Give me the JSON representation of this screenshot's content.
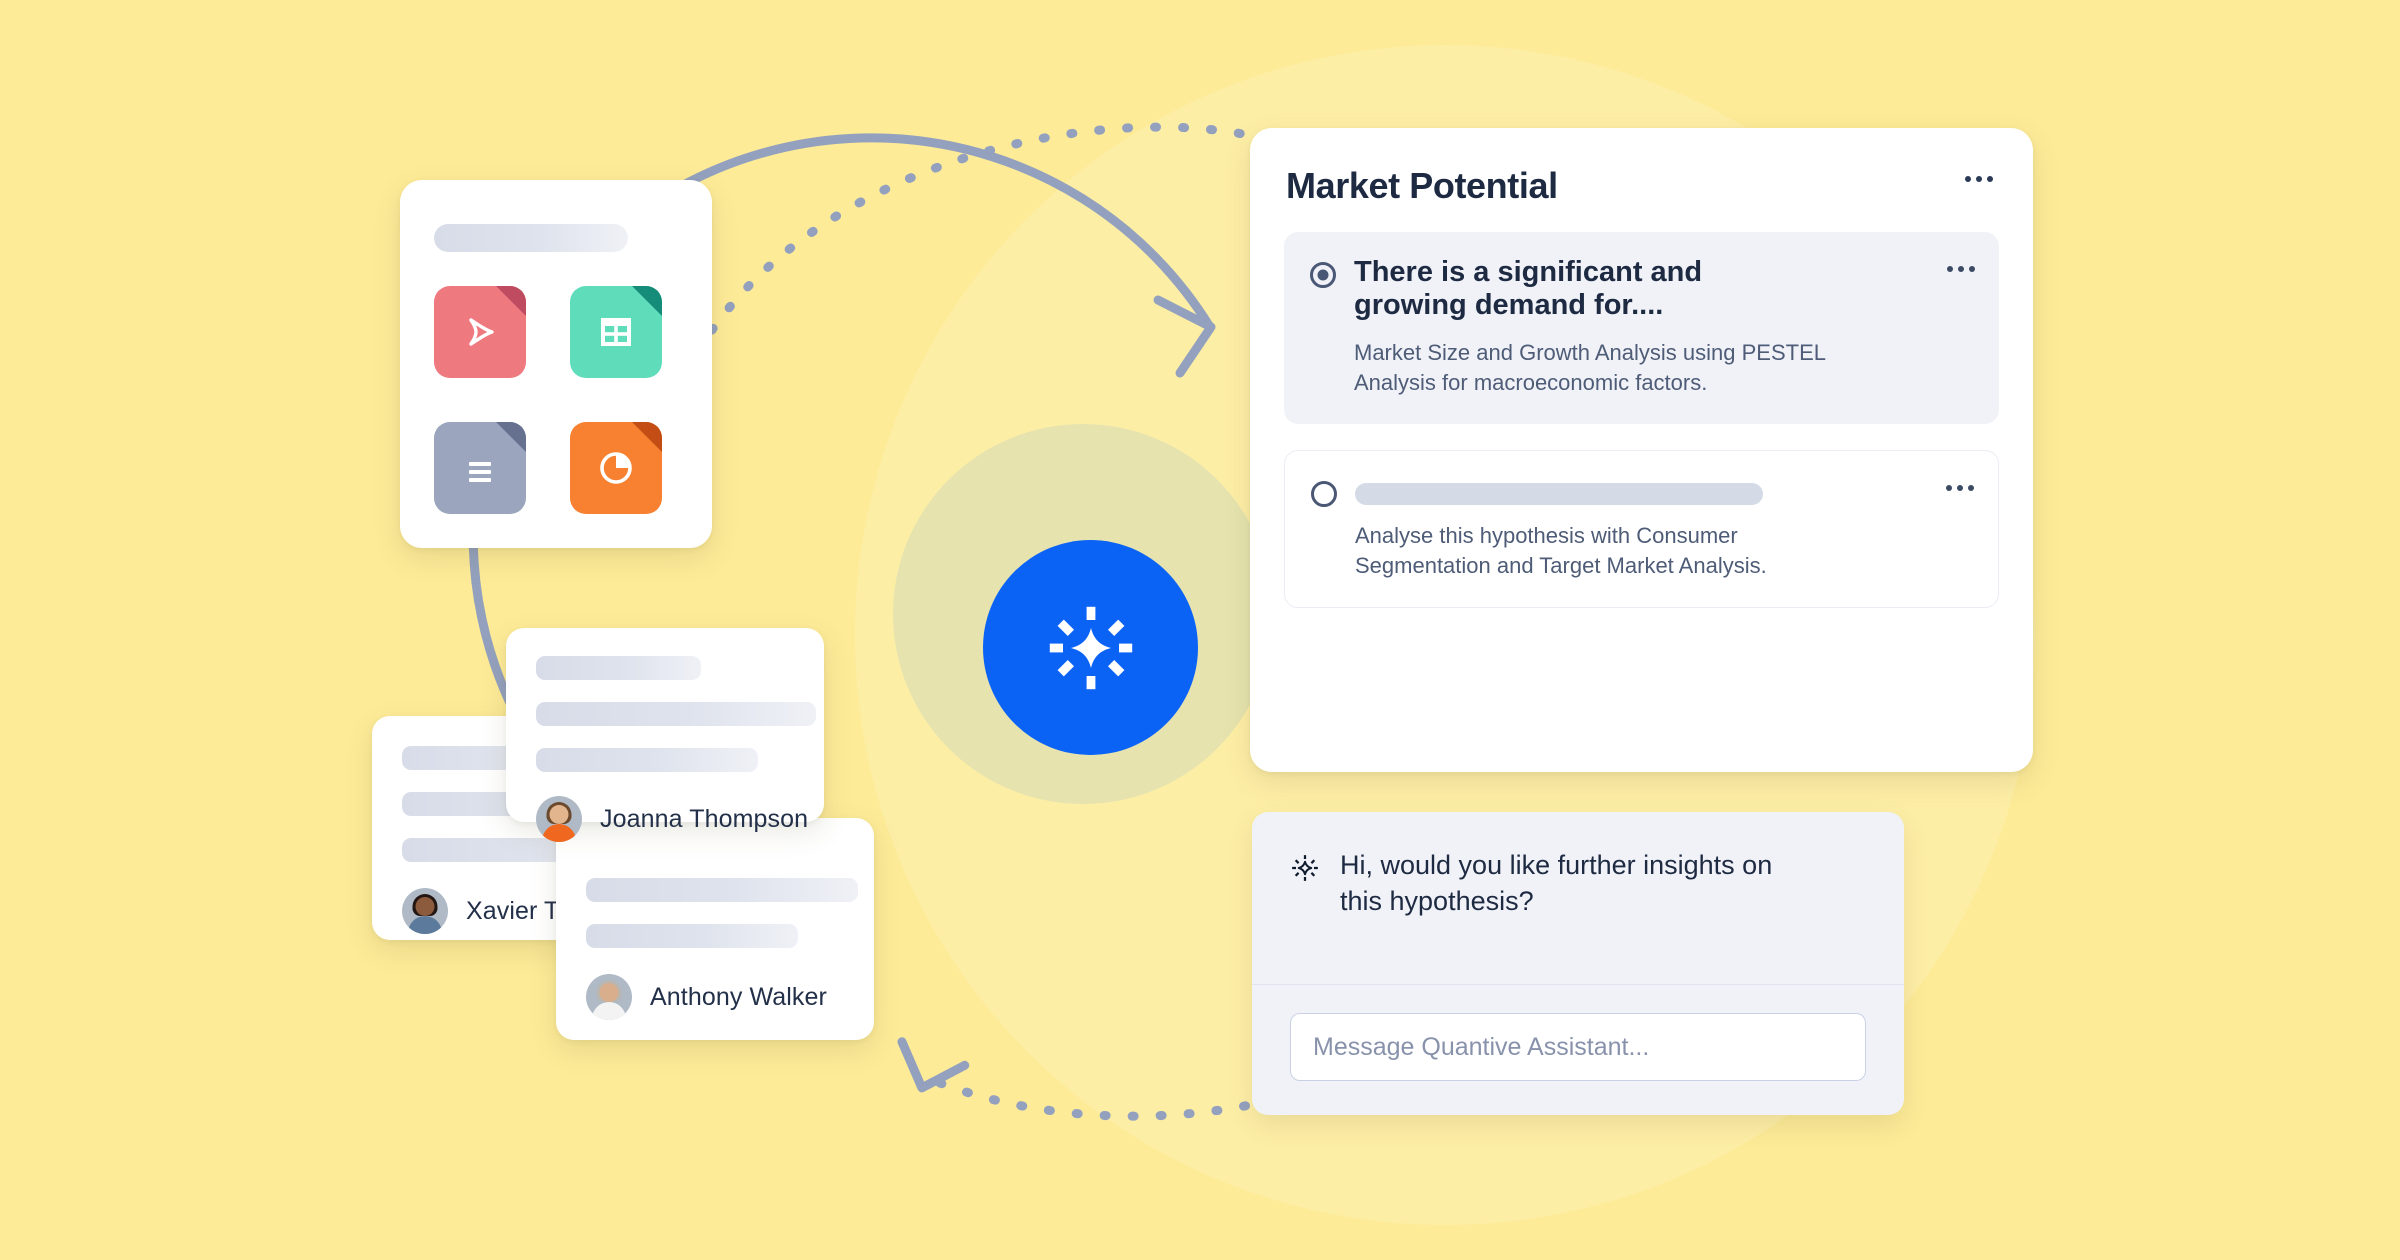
{
  "theme": {
    "background": "#FDEB98",
    "soft_circle": "#FCEFAC",
    "halo": "#E6E3AE",
    "orb": "#0B63F6",
    "accent_text": "#1D2A42",
    "muted_text": "#4E5C77",
    "panel": "#F0F2F8",
    "arc_stroke": "#93A1BE"
  },
  "orb": {
    "icon": "sparkle-icon"
  },
  "files_card": {
    "title_placeholder": "",
    "tiles": [
      {
        "name": "pdf-file-icon",
        "label": "PDF",
        "color": "#EE7A80",
        "fold": "#BE4B5F"
      },
      {
        "name": "spreadsheet-file-icon",
        "label": "Spreadsheet",
        "color": "#5FDDBB",
        "fold": "#158C79"
      },
      {
        "name": "document-file-icon",
        "label": "Document",
        "color": "#9BA6BE",
        "fold": "#66718F"
      },
      {
        "name": "chart-file-icon",
        "label": "Chart",
        "color": "#F78031",
        "fold": "#C34D15"
      }
    ]
  },
  "people_cards": [
    {
      "name": "Xavier Tu",
      "avatar": "xavier-avatar",
      "skin": "#8C5B3E",
      "hair": "#241713",
      "shirt": "#5C7A9B"
    },
    {
      "name": "Joanna Thompson",
      "avatar": "joanna-avatar",
      "skin": "#E2B58F",
      "hair": "#6B4A2E",
      "shirt": "#F0681F"
    },
    {
      "name": "Anthony Walker",
      "avatar": "anthony-avatar",
      "skin": "#D8AE8C",
      "hair": "#B9B6B2",
      "shirt": "#F3F3F3"
    }
  ],
  "market_card": {
    "title": "Market Potential",
    "menu_icon": "more-options-icon",
    "hypotheses": [
      {
        "selected": true,
        "title": "There is a significant and growing demand for....",
        "subtitle": "Market Size and Growth Analysis using PESTEL Analysis for macroeconomic factors.",
        "has_skeleton_title": false,
        "menu_icon": "more-options-icon"
      },
      {
        "selected": false,
        "title": "",
        "subtitle": "Analyse this hypothesis with  Consumer Segmentation and Target Market Analysis.",
        "has_skeleton_title": true,
        "menu_icon": "more-options-icon"
      }
    ]
  },
  "assistant": {
    "icon": "sparkle-icon",
    "message": "Hi, would you like further insights on this hypothesis?",
    "input_placeholder": "Message Quantive Assistant...",
    "input_value": ""
  }
}
